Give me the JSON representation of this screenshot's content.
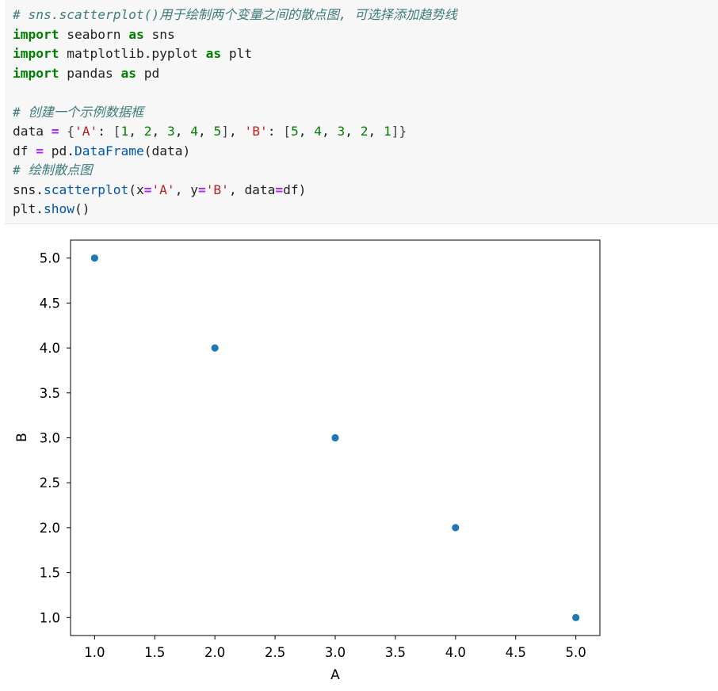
{
  "code_cell": {
    "line1_comment": "# sns.scatterplot()用于绘制两个变量之间的散点图, 可选择添加趋势线",
    "kw_import": "import",
    "kw_as": "as",
    "mod_seaborn": "seaborn",
    "alias_sns": "sns",
    "mod_pyplot": "matplotlib.pyplot",
    "alias_plt": "plt",
    "mod_pandas": "pandas",
    "alias_pd": "pd",
    "comment_create": "# 创建一个示例数据框",
    "var_data": "data",
    "op_eq": "=",
    "brace_open": "{",
    "brace_close": "}",
    "key_a": "'A'",
    "key_b": "'B'",
    "colon": ": ",
    "comma_sp": ", ",
    "bracket_open": "[",
    "bracket_close": "]",
    "nums": [
      "1",
      "2",
      "3",
      "4",
      "5"
    ],
    "nums_rev": [
      "5",
      "4",
      "3",
      "2",
      "1"
    ],
    "var_df": "df",
    "pd_prefix": "pd.",
    "fn_dataframe": "DataFrame",
    "arg_data": "(data)",
    "comment_plot": "# 绘制散点图",
    "sns_prefix": "sns.",
    "fn_scatterplot": "scatterplot",
    "paren_open": "(",
    "paren_close": ")",
    "kw_x": "x",
    "kw_y": "y",
    "kw_data": "data",
    "val_a": "'A'",
    "val_b": "'B'",
    "val_df": "df",
    "plt_prefix": "plt.",
    "fn_show": "show",
    "empty_call": "()"
  },
  "chart_data": {
    "type": "scatter",
    "title": "",
    "xlabel": "A",
    "ylabel": "B",
    "x": [
      1,
      2,
      3,
      4,
      5
    ],
    "y": [
      5,
      4,
      3,
      2,
      1
    ],
    "xlim": [
      0.8,
      5.2
    ],
    "ylim": [
      0.8,
      5.2
    ],
    "xticks": [
      "1.0",
      "1.5",
      "2.0",
      "2.5",
      "3.0",
      "3.5",
      "4.0",
      "4.5",
      "5.0"
    ],
    "yticks": [
      "1.0",
      "1.5",
      "2.0",
      "2.5",
      "3.0",
      "3.5",
      "4.0",
      "4.5",
      "5.0"
    ],
    "xtick_values": [
      1,
      1.5,
      2,
      2.5,
      3,
      3.5,
      4,
      4.5,
      5
    ],
    "ytick_values": [
      1,
      1.5,
      2,
      2.5,
      3,
      3.5,
      4,
      4.5,
      5
    ],
    "grid": false,
    "point_color": "#1f77b4"
  }
}
